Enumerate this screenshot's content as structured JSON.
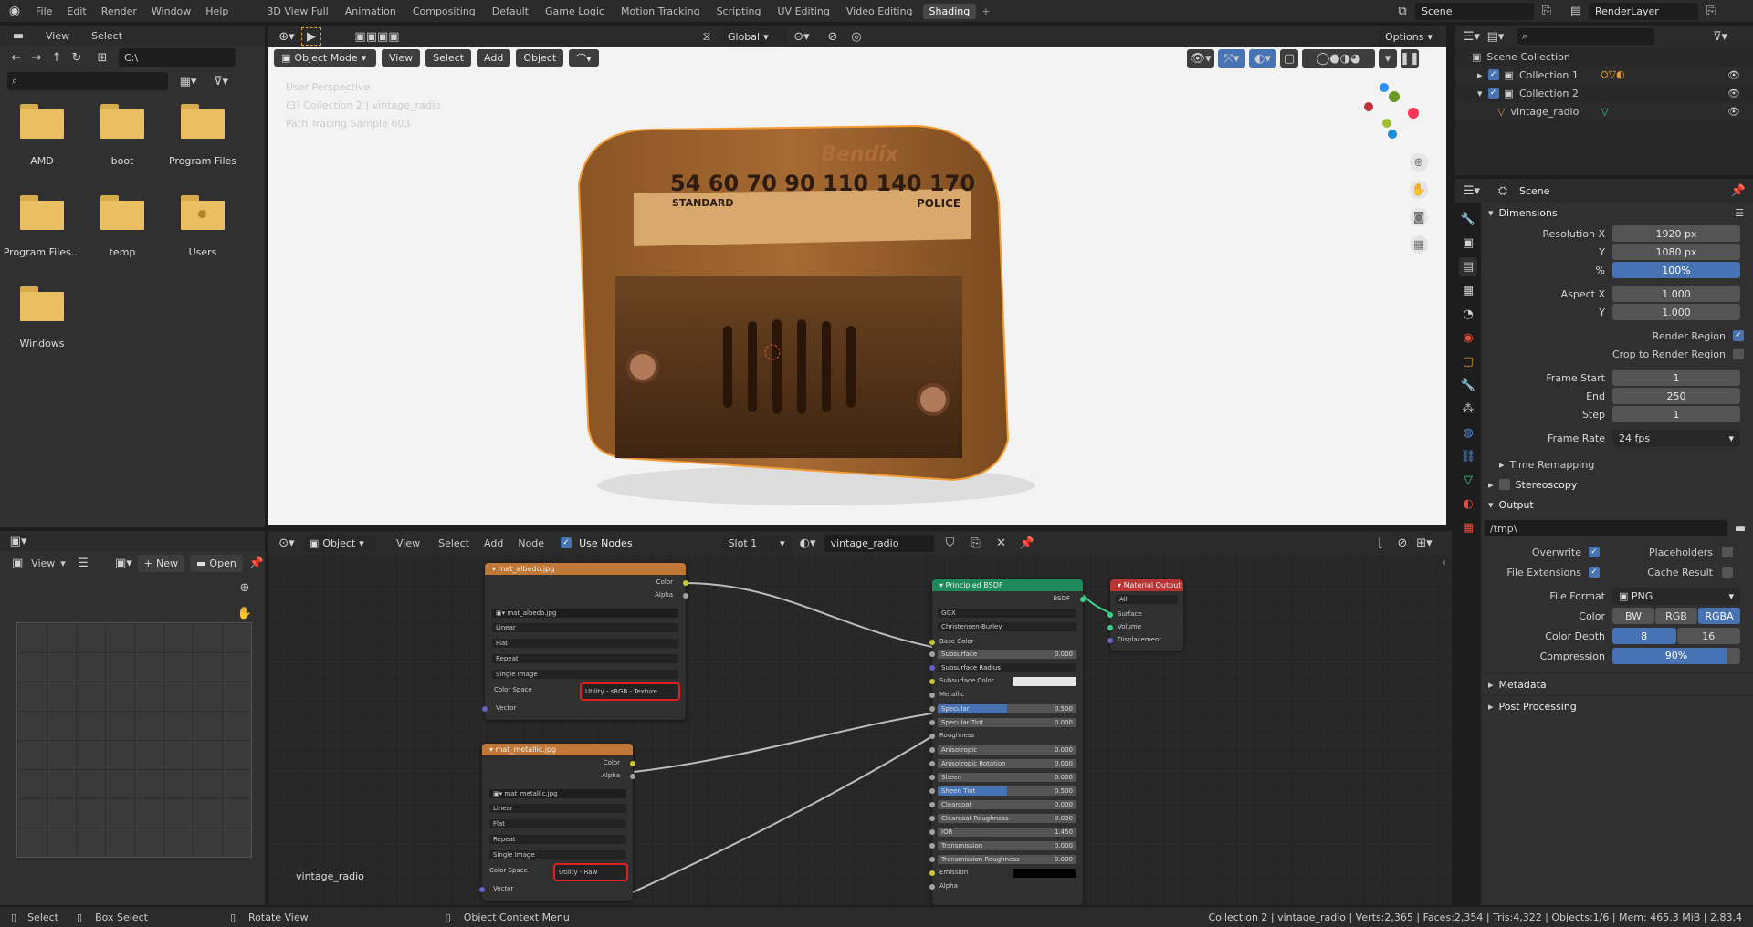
{
  "topbar": {
    "menus": [
      "File",
      "Edit",
      "Render",
      "Window",
      "Help"
    ],
    "workspaces": [
      "3D View Full",
      "Animation",
      "Compositing",
      "Default",
      "Game Logic",
      "Motion Tracking",
      "Scripting",
      "UV Editing",
      "Video Editing",
      "Shading"
    ],
    "active_workspace": "Shading",
    "scene": "Scene",
    "view_layer": "RenderLayer"
  },
  "file_browser": {
    "menus": [
      "View",
      "Select"
    ],
    "path": "C:\\",
    "folders": [
      "AMD",
      "boot",
      "Program Files",
      "Program Files...",
      "temp",
      "Users",
      "Windows"
    ]
  },
  "viewport": {
    "mode": "Object Mode",
    "menus": [
      "View",
      "Select",
      "Add",
      "Object"
    ],
    "transform": "Global",
    "options": "Options",
    "overlay_lines": [
      "User Perspective",
      "(3) Collection 2 | vintage_radio",
      "Path Tracing Sample 603"
    ]
  },
  "radio": {
    "brand": "Bendix",
    "dial": "54 60 70 90 110 140 170",
    "left": "STANDARD",
    "right": "POLICE"
  },
  "node_editor": {
    "type": "Object",
    "menus": [
      "View",
      "Select",
      "Add",
      "Node"
    ],
    "use_nodes": "Use Nodes",
    "slot": "Slot 1",
    "material": "vintage_radio",
    "label": "vintage_radio"
  },
  "image_editor": {
    "view": "View",
    "new": "New",
    "open": "Open"
  },
  "nodes": {
    "albedo": {
      "title": "mat_albedo.jpg",
      "out1": "Color",
      "out2": "Alpha",
      "image": "mat_albedo.jpg",
      "interp": "Linear",
      "proj": "Flat",
      "ext": "Repeat",
      "source": "Single Image",
      "cs_label": "Color Space",
      "cs_value": "Utility - sRGB - Texture",
      "vector": "Vector"
    },
    "metallic": {
      "title": "mat_metallic.jpg",
      "out1": "Color",
      "out2": "Alpha",
      "image": "mat_metallic.jpg",
      "interp": "Linear",
      "proj": "Flat",
      "ext": "Repeat",
      "source": "Single Image",
      "cs_label": "Color Space",
      "cs_value": "Utility - Raw",
      "vector": "Vector"
    },
    "bsdf": {
      "title": "Principled BSDF",
      "out": "BSDF",
      "dist": "GGX",
      "sss": "Christensen-Burley",
      "base_color": "Base Color",
      "rows": [
        [
          "Subsurface",
          "0.000"
        ],
        [
          "Subsurface Radius",
          ""
        ],
        [
          "Subsurface Color",
          ""
        ],
        [
          "Metallic",
          ""
        ],
        [
          "Specular",
          "0.500"
        ],
        [
          "Specular Tint",
          "0.000"
        ],
        [
          "Roughness",
          ""
        ],
        [
          "Anisotropic",
          "0.000"
        ],
        [
          "Anisotropic Rotation",
          "0.000"
        ],
        [
          "Sheen",
          "0.000"
        ],
        [
          "Sheen Tint",
          "0.500"
        ],
        [
          "Clearcoat",
          "0.000"
        ],
        [
          "Clearcoat Roughness",
          "0.030"
        ],
        [
          "IOR",
          "1.450"
        ],
        [
          "Transmission",
          "0.000"
        ],
        [
          "Transmission Roughness",
          "0.000"
        ],
        [
          "Emission",
          ""
        ],
        [
          "Alpha",
          ""
        ]
      ]
    },
    "output": {
      "title": "Material Output",
      "target": "All",
      "sockets": [
        "Surface",
        "Volume",
        "Displacement"
      ]
    }
  },
  "outliner": {
    "root": "Scene Collection",
    "items": [
      "Collection 1",
      "Collection 2",
      "vintage_radio"
    ]
  },
  "properties": {
    "context": "Scene",
    "dimensions": "Dimensions",
    "res_x_label": "Resolution X",
    "res_x": "1920 px",
    "res_y_label": "Y",
    "res_y": "1080 px",
    "pct_label": "%",
    "pct": "100%",
    "asp_x_label": "Aspect X",
    "asp_x": "1.000",
    "asp_y_label": "Y",
    "asp_y": "1.000",
    "render_region": "Render Region",
    "crop": "Crop to Render Region",
    "frame_start_label": "Frame Start",
    "frame_start": "1",
    "end_label": "End",
    "end": "250",
    "step_label": "Step",
    "step": "1",
    "frame_rate_label": "Frame Rate",
    "frame_rate": "24 fps",
    "time_remap": "Time Remapping",
    "stereo": "Stereoscopy",
    "output": "Output",
    "path": "/tmp\\",
    "overwrite": "Overwrite",
    "placeholders": "Placeholders",
    "file_ext": "File Extensions",
    "cache": "Cache Result",
    "file_format_label": "File Format",
    "file_format": "PNG",
    "color_label": "Color",
    "color_opts": [
      "BW",
      "RGB",
      "RGBA"
    ],
    "depth_label": "Color Depth",
    "depths": [
      "8",
      "16"
    ],
    "compression_label": "Compression",
    "compression": "90%",
    "metadata": "Metadata",
    "post": "Post Processing"
  },
  "statusbar": {
    "select": "Select",
    "box": "Box Select",
    "rotate": "Rotate View",
    "context": "Object Context Menu",
    "stats": "Collection 2 | vintage_radio | Verts:2,365 | Faces:2,354 | Tris:4,322 | Objects:1/6 | Mem: 465.3 MiB | 2.83.4"
  }
}
